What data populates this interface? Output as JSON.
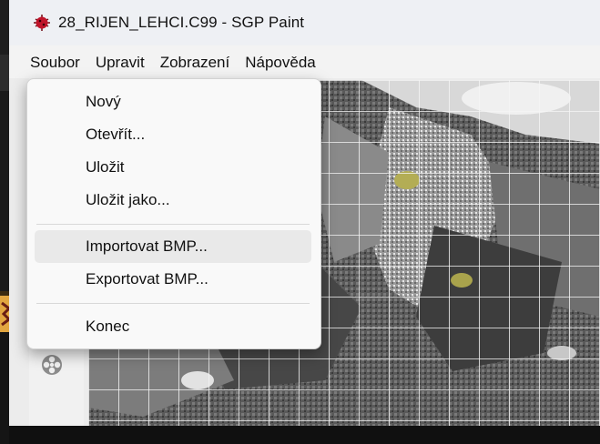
{
  "window": {
    "title": "28_RIJEN_LEHCI.C99 - SGP Paint"
  },
  "menubar": {
    "items": [
      "Soubor",
      "Upravit",
      "Zobrazení",
      "Nápověda"
    ]
  },
  "soubor_menu": {
    "items": [
      {
        "label": "Nový"
      },
      {
        "label": "Otevřít..."
      },
      {
        "label": "Uložit"
      },
      {
        "label": "Uložit jako..."
      },
      {
        "label": "Importovat BMP...",
        "hovered": true
      },
      {
        "label": "Exportovat BMP..."
      },
      {
        "label": "Konec"
      }
    ]
  },
  "colors": {
    "app_icon": "#c0142a",
    "menu_hover": "#e9e9e9",
    "grid_line": "#f5f5f5"
  },
  "icons": {
    "app": "ladybug-icon",
    "tool": "gear-icon"
  }
}
